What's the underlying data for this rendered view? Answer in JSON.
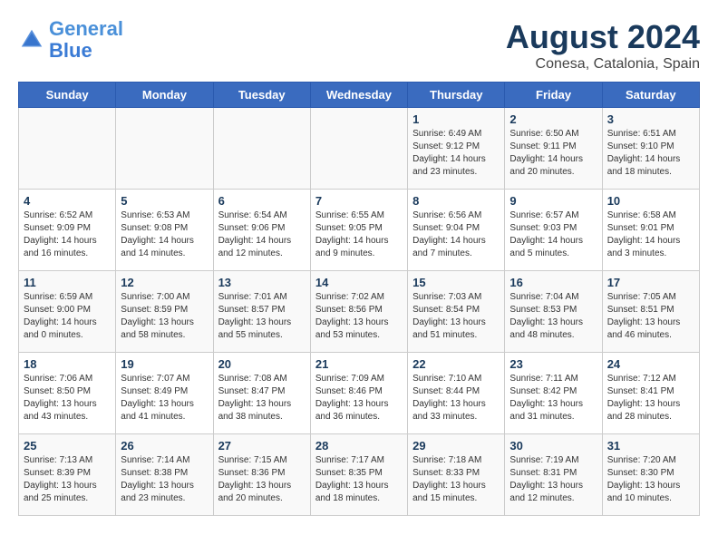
{
  "header": {
    "logo_line1": "General",
    "logo_line2": "Blue",
    "title": "August 2024",
    "subtitle": "Conesa, Catalonia, Spain"
  },
  "days_of_week": [
    "Sunday",
    "Monday",
    "Tuesday",
    "Wednesday",
    "Thursday",
    "Friday",
    "Saturday"
  ],
  "weeks": [
    [
      {
        "day": "",
        "info": ""
      },
      {
        "day": "",
        "info": ""
      },
      {
        "day": "",
        "info": ""
      },
      {
        "day": "",
        "info": ""
      },
      {
        "day": "1",
        "info": "Sunrise: 6:49 AM\nSunset: 9:12 PM\nDaylight: 14 hours\nand 23 minutes."
      },
      {
        "day": "2",
        "info": "Sunrise: 6:50 AM\nSunset: 9:11 PM\nDaylight: 14 hours\nand 20 minutes."
      },
      {
        "day": "3",
        "info": "Sunrise: 6:51 AM\nSunset: 9:10 PM\nDaylight: 14 hours\nand 18 minutes."
      }
    ],
    [
      {
        "day": "4",
        "info": "Sunrise: 6:52 AM\nSunset: 9:09 PM\nDaylight: 14 hours\nand 16 minutes."
      },
      {
        "day": "5",
        "info": "Sunrise: 6:53 AM\nSunset: 9:08 PM\nDaylight: 14 hours\nand 14 minutes."
      },
      {
        "day": "6",
        "info": "Sunrise: 6:54 AM\nSunset: 9:06 PM\nDaylight: 14 hours\nand 12 minutes."
      },
      {
        "day": "7",
        "info": "Sunrise: 6:55 AM\nSunset: 9:05 PM\nDaylight: 14 hours\nand 9 minutes."
      },
      {
        "day": "8",
        "info": "Sunrise: 6:56 AM\nSunset: 9:04 PM\nDaylight: 14 hours\nand 7 minutes."
      },
      {
        "day": "9",
        "info": "Sunrise: 6:57 AM\nSunset: 9:03 PM\nDaylight: 14 hours\nand 5 minutes."
      },
      {
        "day": "10",
        "info": "Sunrise: 6:58 AM\nSunset: 9:01 PM\nDaylight: 14 hours\nand 3 minutes."
      }
    ],
    [
      {
        "day": "11",
        "info": "Sunrise: 6:59 AM\nSunset: 9:00 PM\nDaylight: 14 hours\nand 0 minutes."
      },
      {
        "day": "12",
        "info": "Sunrise: 7:00 AM\nSunset: 8:59 PM\nDaylight: 13 hours\nand 58 minutes."
      },
      {
        "day": "13",
        "info": "Sunrise: 7:01 AM\nSunset: 8:57 PM\nDaylight: 13 hours\nand 55 minutes."
      },
      {
        "day": "14",
        "info": "Sunrise: 7:02 AM\nSunset: 8:56 PM\nDaylight: 13 hours\nand 53 minutes."
      },
      {
        "day": "15",
        "info": "Sunrise: 7:03 AM\nSunset: 8:54 PM\nDaylight: 13 hours\nand 51 minutes."
      },
      {
        "day": "16",
        "info": "Sunrise: 7:04 AM\nSunset: 8:53 PM\nDaylight: 13 hours\nand 48 minutes."
      },
      {
        "day": "17",
        "info": "Sunrise: 7:05 AM\nSunset: 8:51 PM\nDaylight: 13 hours\nand 46 minutes."
      }
    ],
    [
      {
        "day": "18",
        "info": "Sunrise: 7:06 AM\nSunset: 8:50 PM\nDaylight: 13 hours\nand 43 minutes."
      },
      {
        "day": "19",
        "info": "Sunrise: 7:07 AM\nSunset: 8:49 PM\nDaylight: 13 hours\nand 41 minutes."
      },
      {
        "day": "20",
        "info": "Sunrise: 7:08 AM\nSunset: 8:47 PM\nDaylight: 13 hours\nand 38 minutes."
      },
      {
        "day": "21",
        "info": "Sunrise: 7:09 AM\nSunset: 8:46 PM\nDaylight: 13 hours\nand 36 minutes."
      },
      {
        "day": "22",
        "info": "Sunrise: 7:10 AM\nSunset: 8:44 PM\nDaylight: 13 hours\nand 33 minutes."
      },
      {
        "day": "23",
        "info": "Sunrise: 7:11 AM\nSunset: 8:42 PM\nDaylight: 13 hours\nand 31 minutes."
      },
      {
        "day": "24",
        "info": "Sunrise: 7:12 AM\nSunset: 8:41 PM\nDaylight: 13 hours\nand 28 minutes."
      }
    ],
    [
      {
        "day": "25",
        "info": "Sunrise: 7:13 AM\nSunset: 8:39 PM\nDaylight: 13 hours\nand 25 minutes."
      },
      {
        "day": "26",
        "info": "Sunrise: 7:14 AM\nSunset: 8:38 PM\nDaylight: 13 hours\nand 23 minutes."
      },
      {
        "day": "27",
        "info": "Sunrise: 7:15 AM\nSunset: 8:36 PM\nDaylight: 13 hours\nand 20 minutes."
      },
      {
        "day": "28",
        "info": "Sunrise: 7:17 AM\nSunset: 8:35 PM\nDaylight: 13 hours\nand 18 minutes."
      },
      {
        "day": "29",
        "info": "Sunrise: 7:18 AM\nSunset: 8:33 PM\nDaylight: 13 hours\nand 15 minutes."
      },
      {
        "day": "30",
        "info": "Sunrise: 7:19 AM\nSunset: 8:31 PM\nDaylight: 13 hours\nand 12 minutes."
      },
      {
        "day": "31",
        "info": "Sunrise: 7:20 AM\nSunset: 8:30 PM\nDaylight: 13 hours\nand 10 minutes."
      }
    ]
  ]
}
